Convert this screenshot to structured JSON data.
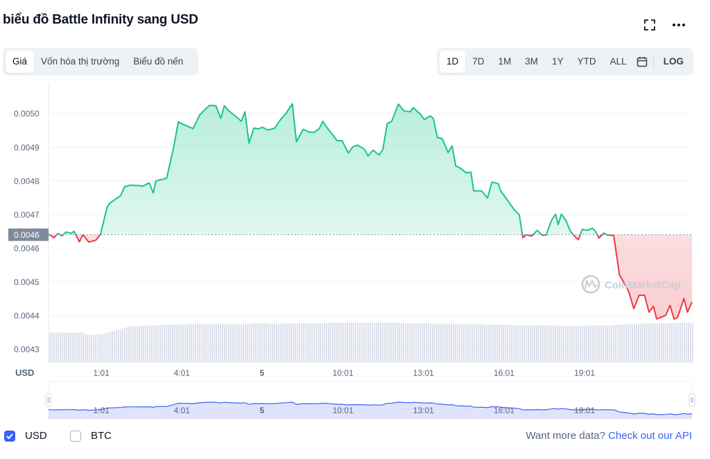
{
  "title": "biểu đồ Battle Infinity sang USD",
  "icons": {
    "fullscreen": "fullscreen-icon",
    "more": "more-options-icon",
    "calendar": "calendar-icon",
    "brand": "coinmarketcap-logo"
  },
  "view_tabs": [
    {
      "label": "Giá",
      "active": true
    },
    {
      "label": "Vốn hóa thị trường",
      "active": false
    },
    {
      "label": "Biểu đồ nến",
      "active": false
    }
  ],
  "range_tabs": [
    {
      "label": "1D",
      "active": true
    },
    {
      "label": "7D",
      "active": false
    },
    {
      "label": "1M",
      "active": false
    },
    {
      "label": "3M",
      "active": false
    },
    {
      "label": "1Y",
      "active": false
    },
    {
      "label": "YTD",
      "active": false
    },
    {
      "label": "ALL",
      "active": false
    }
  ],
  "log_label": "LOG",
  "footer": {
    "usd_label": "USD",
    "usd_checked": true,
    "btc_label": "BTC",
    "btc_checked": false,
    "more_text": "Want more data?",
    "api_link": "Check out our API"
  },
  "colors": {
    "up": "#16c784",
    "down": "#ea3943",
    "brand": "#3861fb",
    "navigator_fill": "#dfe3fb"
  },
  "chart_data": {
    "type": "line",
    "currency_label": "USD",
    "watermark": "CoinMarketCap",
    "reference_price": 0.00464,
    "reference_label": "0.0046",
    "y_ticks": [
      "0.0050",
      "0.0049",
      "0.0048",
      "0.0047",
      "0.0046",
      "0.0045",
      "0.0044",
      "0.0043"
    ],
    "y_tick_values": [
      0.005,
      0.0049,
      0.0048,
      0.0047,
      0.0046,
      0.0045,
      0.0044,
      0.0043
    ],
    "ylim": [
      0.00426,
      0.00509
    ],
    "x_ticks": [
      "1:01",
      "4:01",
      "5",
      "10:01",
      "13:01",
      "16:01",
      "19:01"
    ],
    "x_tick_values": [
      61,
      241,
      420,
      601,
      781,
      961,
      1141
    ],
    "xlim": [
      -57,
      1381
    ],
    "series": [
      {
        "x": [
          -57,
          -45,
          -36,
          -27,
          -18,
          -6,
          0,
          12,
          20,
          33,
          49,
          59,
          74,
          80,
          104,
          113,
          126,
          145,
          153,
          168,
          177,
          183,
          199,
          207,
          223,
          233,
          247,
          254,
          266,
          281,
          295,
          303,
          317,
          328,
          336,
          345,
          360,
          374,
          382,
          391,
          402,
          412,
          421,
          433,
          448,
          461,
          474,
          488,
          497,
          512,
          525,
          536,
          548,
          556,
          566,
          578,
          588,
          599,
          613,
          623,
          634,
          649,
          657,
          668,
          682,
          690,
          700,
          710,
          725,
          737,
          751,
          758,
          774,
          783,
          796,
          803,
          812,
          823,
          836,
          845,
          853,
          864,
          876,
          887,
          893,
          900,
          911,
          924,
          934,
          948,
          953,
          969,
          983,
          995,
          1003,
          1011,
          1023,
          1035,
          1046,
          1055,
          1068,
          1076,
          1082,
          1089,
          1099,
          1109,
          1118,
          1127,
          1136,
          1147,
          1159,
          1165,
          1173,
          1184,
          1192,
          1206,
          1219,
          1231,
          1240,
          1251,
          1263,
          1275,
          1285,
          1295,
          1302,
          1311,
          1322,
          1332,
          1341,
          1349,
          1363,
          1371,
          1381
        ],
        "y": [
          0.004642,
          0.004631,
          0.004644,
          0.004637,
          0.004648,
          0.004644,
          0.00465,
          0.004619,
          0.00464,
          0.004618,
          0.004624,
          0.004641,
          0.004722,
          0.004734,
          0.004756,
          0.004783,
          0.004787,
          0.004786,
          0.004784,
          0.004794,
          0.004764,
          0.0048,
          0.004805,
          0.004808,
          0.004902,
          0.004975,
          0.004966,
          0.004962,
          0.004955,
          0.004996,
          0.005015,
          0.005024,
          0.005023,
          0.004986,
          0.005023,
          0.005009,
          0.004993,
          0.004977,
          0.005005,
          0.004912,
          0.004957,
          0.004954,
          0.004959,
          0.004951,
          0.004956,
          0.004981,
          0.005001,
          0.005029,
          0.004916,
          0.004953,
          0.004945,
          0.004944,
          0.004955,
          0.004977,
          0.004957,
          0.004937,
          0.004919,
          0.004919,
          0.004883,
          0.004901,
          0.004906,
          0.004894,
          0.004874,
          0.004891,
          0.004877,
          0.004893,
          0.00497,
          0.004977,
          0.005028,
          0.005008,
          0.005005,
          0.005017,
          0.004998,
          0.004982,
          0.004993,
          0.004985,
          0.004929,
          0.004925,
          0.004884,
          0.004904,
          0.004844,
          0.004837,
          0.004824,
          0.004826,
          0.00477,
          0.00477,
          0.00477,
          0.004749,
          0.004796,
          0.004792,
          0.004771,
          0.004742,
          0.004715,
          0.004699,
          0.004631,
          0.00464,
          0.004636,
          0.004653,
          0.004639,
          0.004639,
          0.004685,
          0.004701,
          0.00467,
          0.004701,
          0.004683,
          0.004651,
          0.004636,
          0.004625,
          0.004656,
          0.004653,
          0.004659,
          0.004651,
          0.00463,
          0.004645,
          0.004639,
          0.004638,
          0.00452,
          0.004493,
          0.00447,
          0.00442,
          0.00446,
          0.00446,
          0.00441,
          0.004427,
          0.00439,
          0.004394,
          0.0044,
          0.00443,
          0.004389,
          0.004395,
          0.00445,
          0.00441,
          0.00444
        ]
      }
    ],
    "volume": {
      "x": [
        -57,
        18,
        30,
        60,
        90,
        120,
        150,
        180,
        210,
        240,
        270,
        300,
        330,
        360,
        390,
        420,
        450,
        480,
        510,
        540,
        570,
        600,
        630,
        660,
        690,
        720,
        750,
        780,
        810,
        840,
        870,
        900,
        930,
        960,
        990,
        1020,
        1050,
        1080,
        1110,
        1140,
        1170,
        1200,
        1230,
        1260,
        1290,
        1320,
        1350,
        1381
      ],
      "v": [
        0.62,
        0.62,
        0.57,
        0.58,
        0.66,
        0.74,
        0.76,
        0.77,
        0.78,
        0.79,
        0.8,
        0.8,
        0.8,
        0.79,
        0.8,
        0.81,
        0.8,
        0.81,
        0.81,
        0.81,
        0.82,
        0.82,
        0.82,
        0.82,
        0.82,
        0.82,
        0.81,
        0.81,
        0.8,
        0.8,
        0.79,
        0.79,
        0.78,
        0.78,
        0.77,
        0.77,
        0.77,
        0.76,
        0.76,
        0.76,
        0.77,
        0.77,
        0.79,
        0.8,
        0.81,
        0.81,
        0.82,
        0.82
      ]
    }
  }
}
